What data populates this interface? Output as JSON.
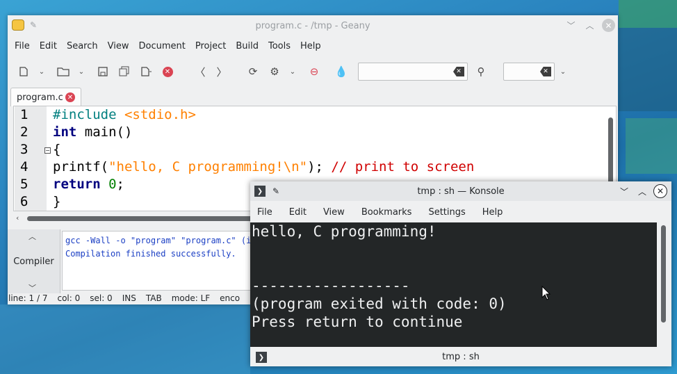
{
  "geany": {
    "title": "program.c - /tmp - Geany",
    "menu": [
      "File",
      "Edit",
      "Search",
      "View",
      "Document",
      "Project",
      "Build",
      "Tools",
      "Help"
    ],
    "tab_label": "program.c",
    "search_value": "",
    "goto_value": "",
    "line_numbers": [
      "1",
      "2",
      "3",
      "4",
      "5",
      "6"
    ],
    "code": {
      "l1_pp": "#include ",
      "l1_inc": "<stdio.h>",
      "l2_kw": "int",
      "l2_rest": " main()",
      "l3": "{",
      "l4_a": "printf(",
      "l4_str": "\"hello, C programming!\\n\"",
      "l4_b": "); ",
      "l4_cmt": "// print to screen",
      "l5_kw": "return",
      "l5_sp": " ",
      "l5_num": "0",
      "l5_end": ";",
      "l6": "}"
    },
    "compiler_tab": "Compiler",
    "messages": [
      "gcc -Wall -o \"program\" \"program.c\" (in",
      "Compilation finished successfully."
    ],
    "status": [
      "line: 1 / 7",
      "col: 0",
      "sel: 0",
      "INS",
      "TAB",
      "mode: LF",
      "enco"
    ]
  },
  "konsole": {
    "title": "tmp : sh — Konsole",
    "menu": [
      "File",
      "Edit",
      "View",
      "Bookmarks",
      "Settings",
      "Help"
    ],
    "terminal_lines": [
      "hello, C programming!",
      "",
      "",
      "------------------",
      "(program exited with code: 0)",
      "Press return to continue"
    ],
    "status_label": "tmp : sh"
  },
  "icons": {
    "geany_app": "geany-icon",
    "pin": "pin-icon",
    "minimize": "chevron-down-icon",
    "maximize": "chevron-up-icon",
    "close": "close-icon"
  },
  "colors": {
    "accent_error": "#da4453",
    "terminal_bg": "#232627",
    "terminal_fg": "#eff0f1",
    "msg_fg": "#1b3fc4"
  }
}
